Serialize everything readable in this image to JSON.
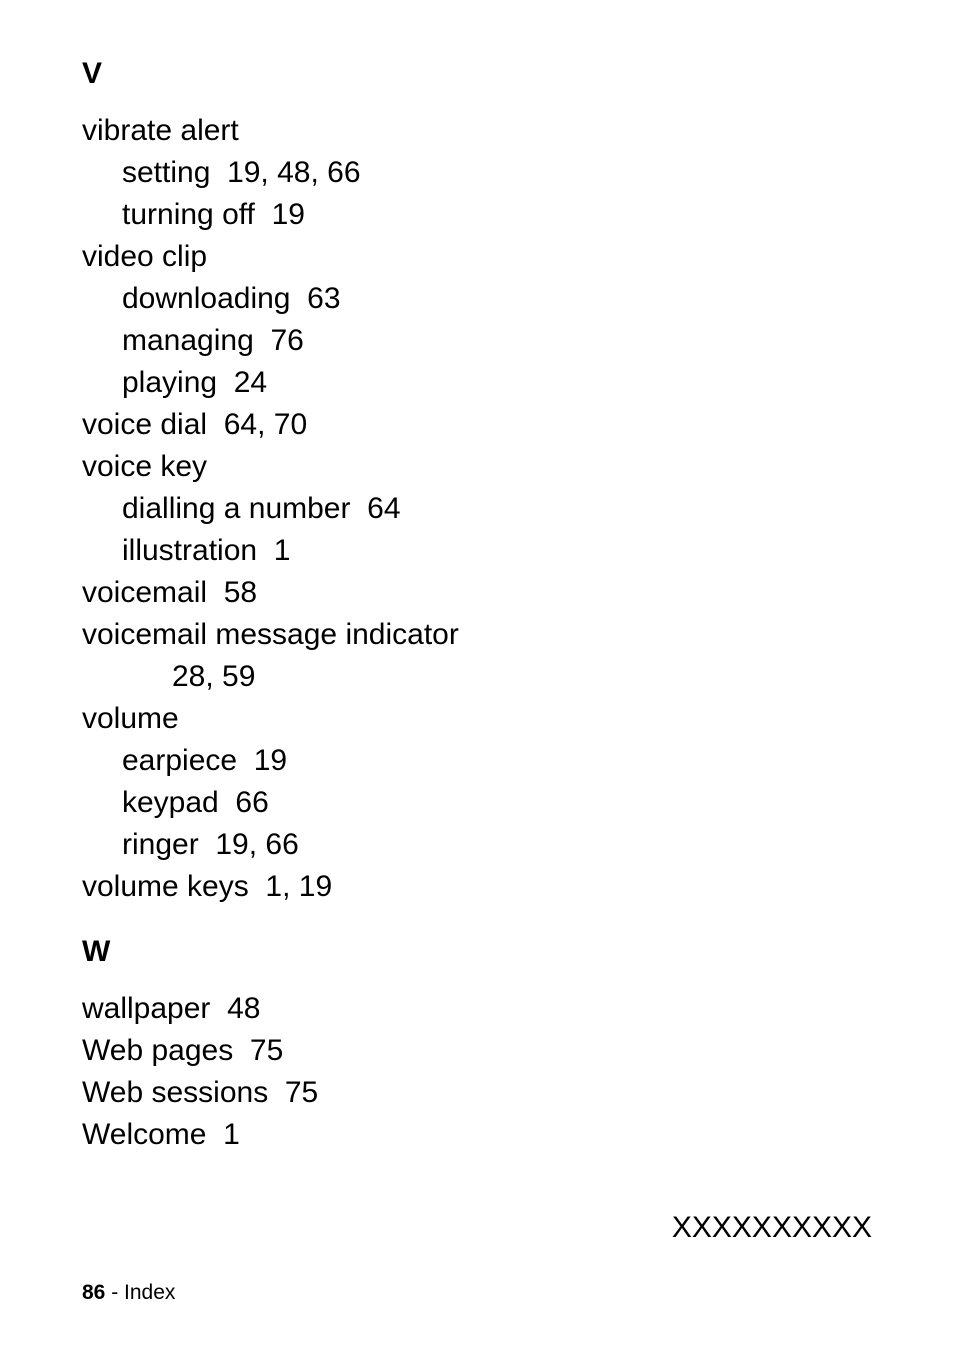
{
  "sections": {
    "v": {
      "heading": "V",
      "items": {
        "vibrate_alert": {
          "label": "vibrate alert",
          "setting": {
            "label": "setting",
            "pages": "19, 48, 66"
          },
          "turning_off": {
            "label": "turning off",
            "pages": "19"
          }
        },
        "video_clip": {
          "label": "video clip",
          "downloading": {
            "label": "downloading",
            "pages": "63"
          },
          "managing": {
            "label": "managing",
            "pages": "76"
          },
          "playing": {
            "label": "playing",
            "pages": "24"
          }
        },
        "voice_dial": {
          "label": "voice dial",
          "pages": "64, 70"
        },
        "voice_key": {
          "label": "voice key",
          "dialling": {
            "label": "dialling a number",
            "pages": "64"
          },
          "illustration": {
            "label": "illustration",
            "pages": "1"
          }
        },
        "voicemail": {
          "label": "voicemail",
          "pages": "58"
        },
        "voicemail_indicator": {
          "label": "voicemail message indicator",
          "pages": "28, 59"
        },
        "volume": {
          "label": "volume",
          "earpiece": {
            "label": "earpiece",
            "pages": "19"
          },
          "keypad": {
            "label": "keypad",
            "pages": "66"
          },
          "ringer": {
            "label": "ringer",
            "pages": "19, 66"
          }
        },
        "volume_keys": {
          "label": "volume keys",
          "pages": "1, 19"
        }
      }
    },
    "w": {
      "heading": "W",
      "items": {
        "wallpaper": {
          "label": "wallpaper",
          "pages": "48"
        },
        "web_pages": {
          "label": "Web pages",
          "pages": "75"
        },
        "web_sessions": {
          "label": "Web sessions",
          "pages": "75"
        },
        "welcome": {
          "label": "Welcome",
          "pages": "1"
        }
      }
    }
  },
  "part_number": "XXXXXXXXXX",
  "footer": {
    "page_number": "86",
    "separator": " - ",
    "label": "Index"
  }
}
